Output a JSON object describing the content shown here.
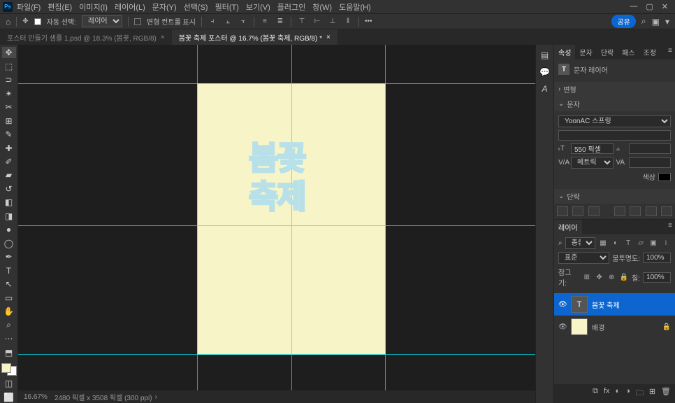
{
  "menu": {
    "file": "파일(F)",
    "edit": "편집(E)",
    "image": "이미지(I)",
    "layer": "레이어(L)",
    "type": "문자(Y)",
    "select": "선택(S)",
    "filter": "필터(T)",
    "view": "보기(V)",
    "plugin": "플러그인",
    "window": "창(W)",
    "help": "도움말(H)"
  },
  "optbar": {
    "autoselect": "자동 선택:",
    "layer": "레이어",
    "transform": "변형 컨트롤 표시",
    "share": "공유"
  },
  "tabs": {
    "t1": "포스터 만들기 샘플 1.psd @ 18.3% (봄꽃, RGB/8)",
    "t2": "봄꽃 축제 포스터 @ 16.7% (봄꽃 축제, RGB/8) *"
  },
  "canvas": {
    "text1": "봄꽃",
    "text2": "축제",
    "zoom": "16.67%",
    "dims": "2480 픽셀 x 3508 픽셀 (300 ppi)"
  },
  "panels": {
    "props": {
      "tab_props": "속성",
      "tab_char": "문자",
      "tab_para": "단락",
      "tab_path": "패스",
      "tab_adj": "조정",
      "title": "문자 레이어",
      "transform": "변형",
      "char": "문자",
      "font": "YoonAC 스프링",
      "size": "550 픽셀",
      "track": "메트릭",
      "color": "색상",
      "para": "단락"
    },
    "layers": {
      "title": "레이어",
      "kind": "종류",
      "blend": "표준",
      "opacity_lbl": "불투명도:",
      "opacity": "100%",
      "lock_lbl": "잠그기:",
      "fill_lbl": "칠:",
      "fill": "100%",
      "layer1": "봄꽃 축제",
      "layer2": "배경"
    }
  }
}
